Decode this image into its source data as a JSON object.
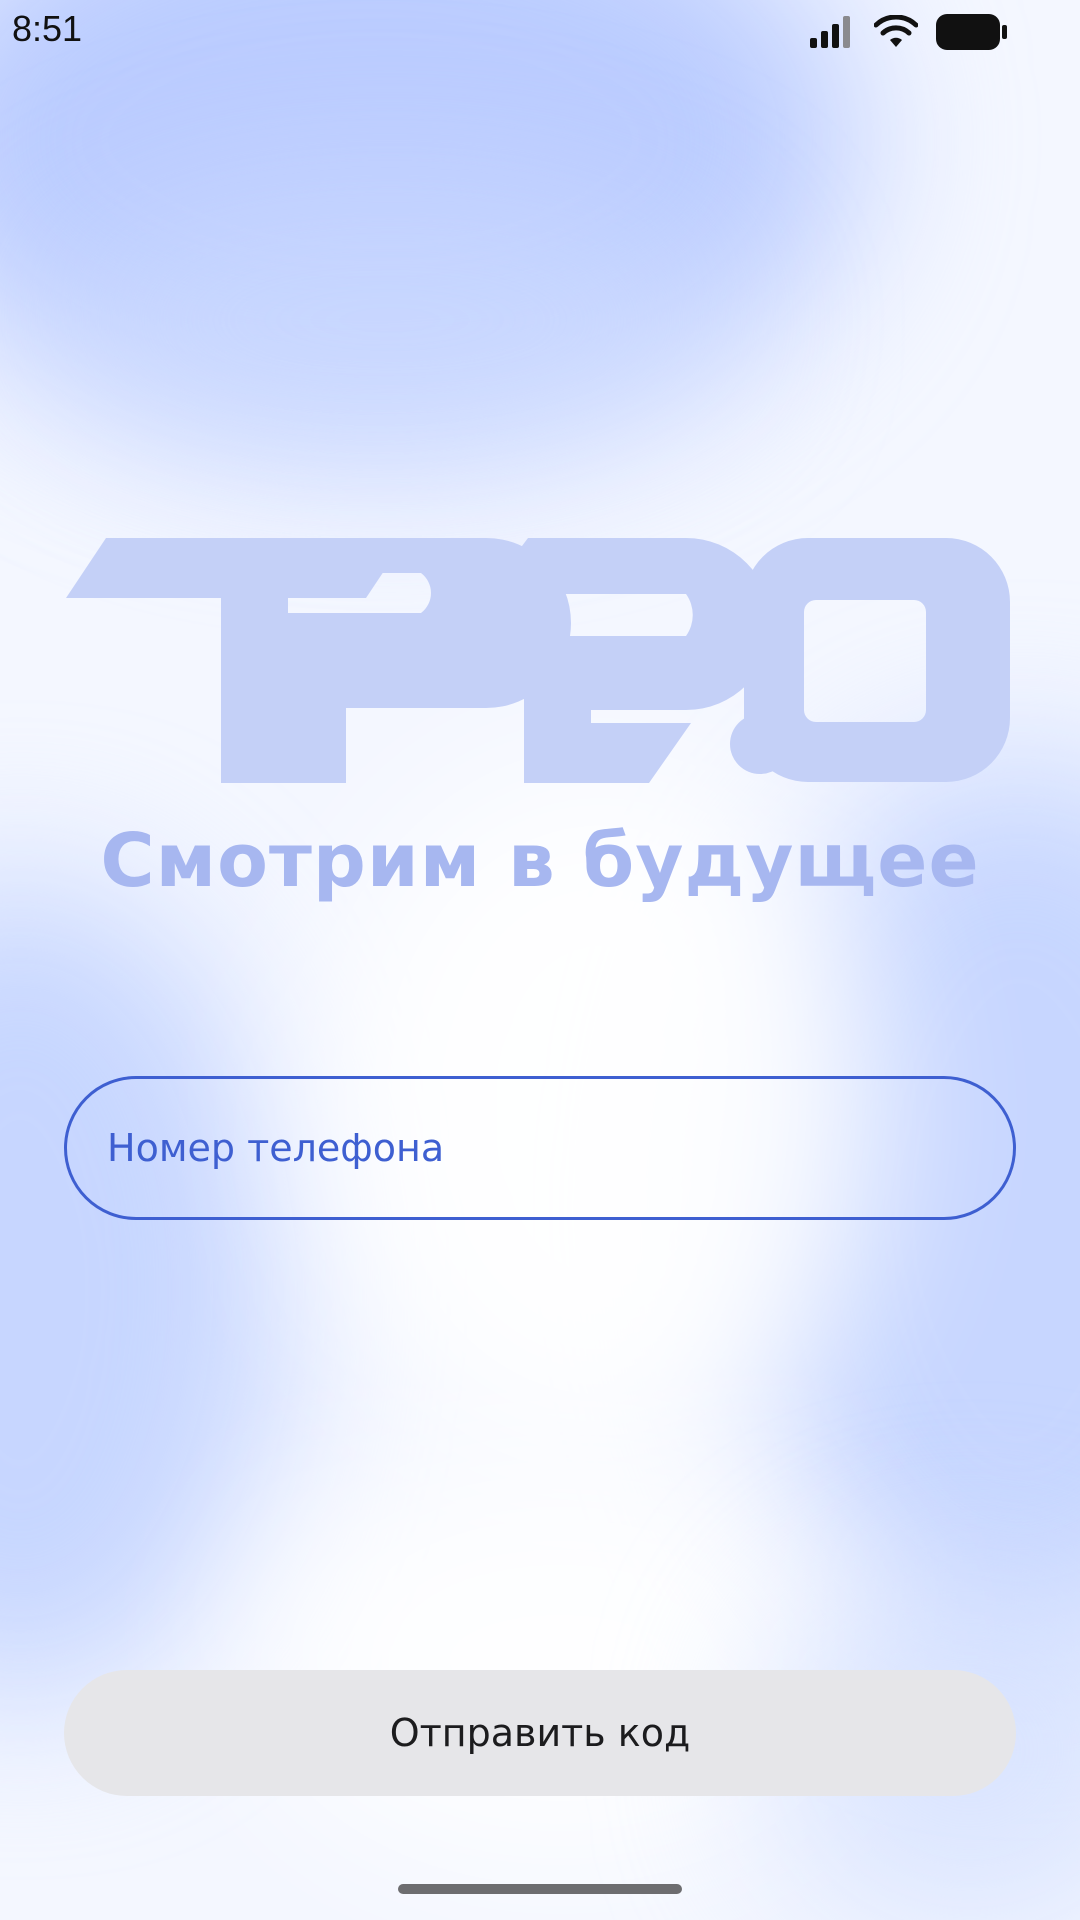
{
  "status_bar": {
    "time": "8:51",
    "icons": [
      "cellular-signal-icon",
      "wifi-icon",
      "battery-icon"
    ]
  },
  "brand": {
    "logo_text": "TP2.0",
    "slogan": "Смотрим в будущее",
    "logo_color": "#c4d0f7",
    "slogan_color": "#a7b7f0"
  },
  "login_form": {
    "phone_placeholder": "Номер телефона",
    "phone_value": "",
    "send_button_label": "Отправить код"
  },
  "colors": {
    "accent": "#3e5fd1",
    "button_bg": "#e6e6e9",
    "button_text": "#1c1c1e"
  }
}
